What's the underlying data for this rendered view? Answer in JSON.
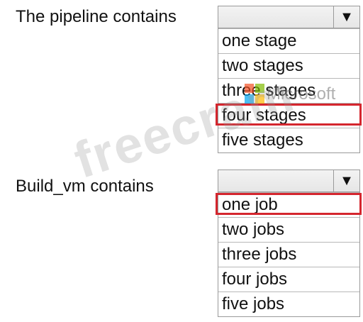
{
  "questions": [
    {
      "label": "The pipeline contains",
      "arrow": "▼",
      "options": [
        "one stage",
        "two stages",
        "three stages",
        "four stages",
        "five stages"
      ],
      "selected_index": 3
    },
    {
      "label": "Build_vm contains",
      "arrow": "▼",
      "options": [
        "one job",
        "two jobs",
        "three jobs",
        "four jobs",
        "five jobs"
      ],
      "selected_index": 0
    }
  ],
  "watermark": {
    "text": "freecram",
    "brand": "Microsoft"
  },
  "colors": {
    "selection_border": "#d4262e",
    "dropdown_bg": "#ececec"
  }
}
